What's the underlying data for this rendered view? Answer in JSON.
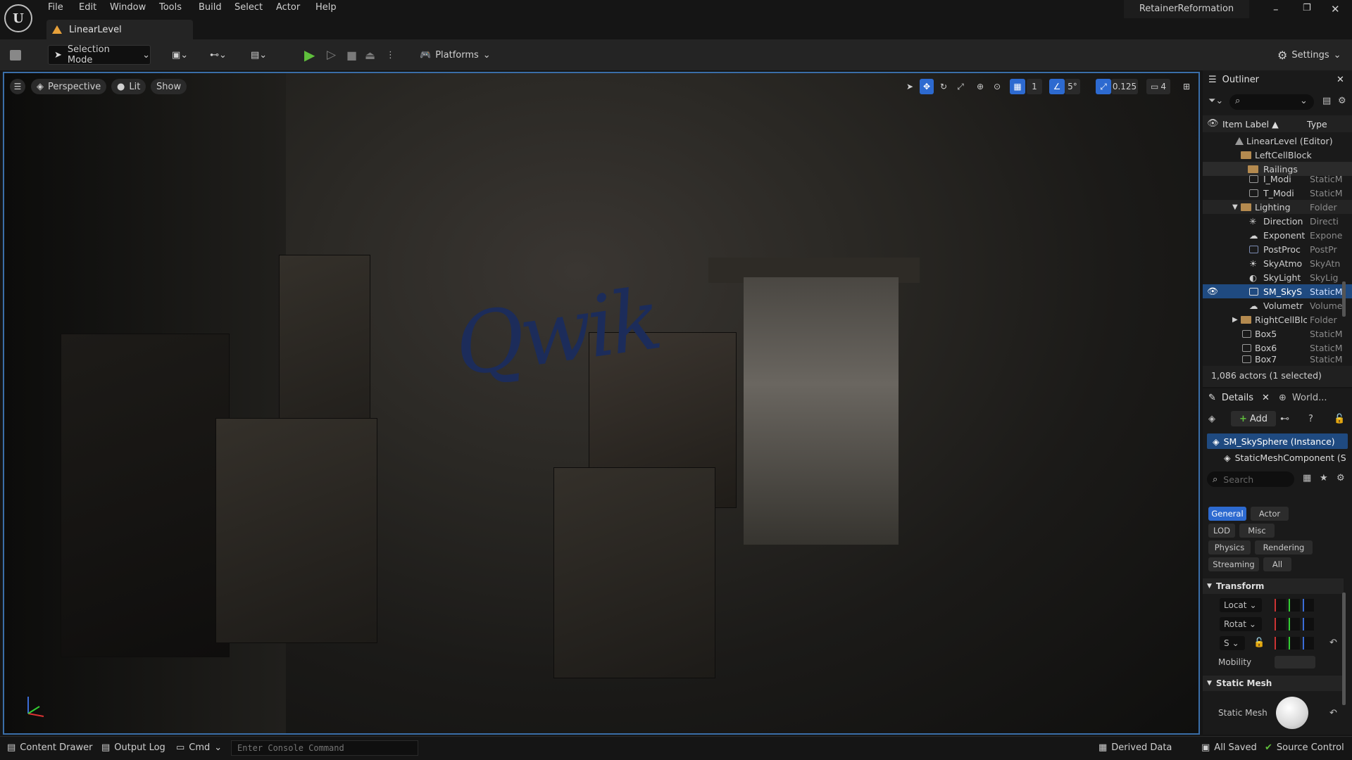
{
  "app": {
    "project_name": "RetainerReformation",
    "level_tab": "LinearLevel",
    "menu": [
      "File",
      "Edit",
      "Window",
      "Tools",
      "Build",
      "Select",
      "Actor",
      "Help"
    ],
    "window_buttons": {
      "minimize": "–",
      "restore": "❐",
      "close": "✕"
    }
  },
  "toolbar": {
    "selection_mode": "Selection Mode",
    "platforms": "Platforms",
    "settings": "Settings"
  },
  "viewport": {
    "perspective": "Perspective",
    "lit": "Lit",
    "show": "Show",
    "grid_snap": "1",
    "rotation_snap": "5°",
    "scale_snap": "0.125",
    "camera_speed": "4",
    "graffiti": "Qwik"
  },
  "outliner": {
    "title": "Outliner",
    "col_label": "Item Label ▲",
    "col_type": "Type",
    "items": [
      {
        "label": "LinearLevel (Editor)",
        "type": ""
      },
      {
        "label": "LeftCellBlock",
        "type": ""
      },
      {
        "label": "Railings",
        "type": ""
      },
      {
        "label": "I_Modi",
        "type": "StaticM"
      },
      {
        "label": "T_Modi",
        "type": "StaticM"
      },
      {
        "label": "Lighting",
        "type": "Folder"
      },
      {
        "label": "Direction",
        "type": "Directi"
      },
      {
        "label": "Exponent",
        "type": "Expone"
      },
      {
        "label": "PostProc",
        "type": "PostPr"
      },
      {
        "label": "SkyAtmo",
        "type": "SkyAtn"
      },
      {
        "label": "SkyLight",
        "type": "SkyLig"
      },
      {
        "label": "SM_SkyS",
        "type": "StaticM"
      },
      {
        "label": "Volumetr",
        "type": "Volume"
      },
      {
        "label": "RightCellBlc",
        "type": "Folder"
      },
      {
        "label": "Box5",
        "type": "StaticM"
      },
      {
        "label": "Box6",
        "type": "StaticM"
      },
      {
        "label": "Box7",
        "type": "StaticM"
      }
    ],
    "footer": "1,086 actors (1 selected)"
  },
  "details": {
    "title": "Details",
    "world_tab": "World...",
    "add": "Add",
    "selected": "SM_SkySphere (Instance)",
    "component": "StaticMeshComponent (S",
    "search_placeholder": "Search",
    "categories": [
      "General",
      "Actor",
      "LOD",
      "Misc",
      "Physics",
      "Rendering",
      "Streaming",
      "All"
    ],
    "transform_header": "Transform",
    "location": "Locat",
    "rotation": "Rotat",
    "scale": "S",
    "mobility": "Mobility",
    "static_mesh_header": "Static Mesh",
    "static_mesh_label": "Static Mesh"
  },
  "statusbar": {
    "content_drawer": "Content Drawer",
    "output_log": "Output Log",
    "cmd": "Cmd",
    "console_placeholder": "Enter Console Command",
    "derived_data": "Derived Data",
    "all_saved": "All Saved",
    "source_control": "Source Control"
  }
}
